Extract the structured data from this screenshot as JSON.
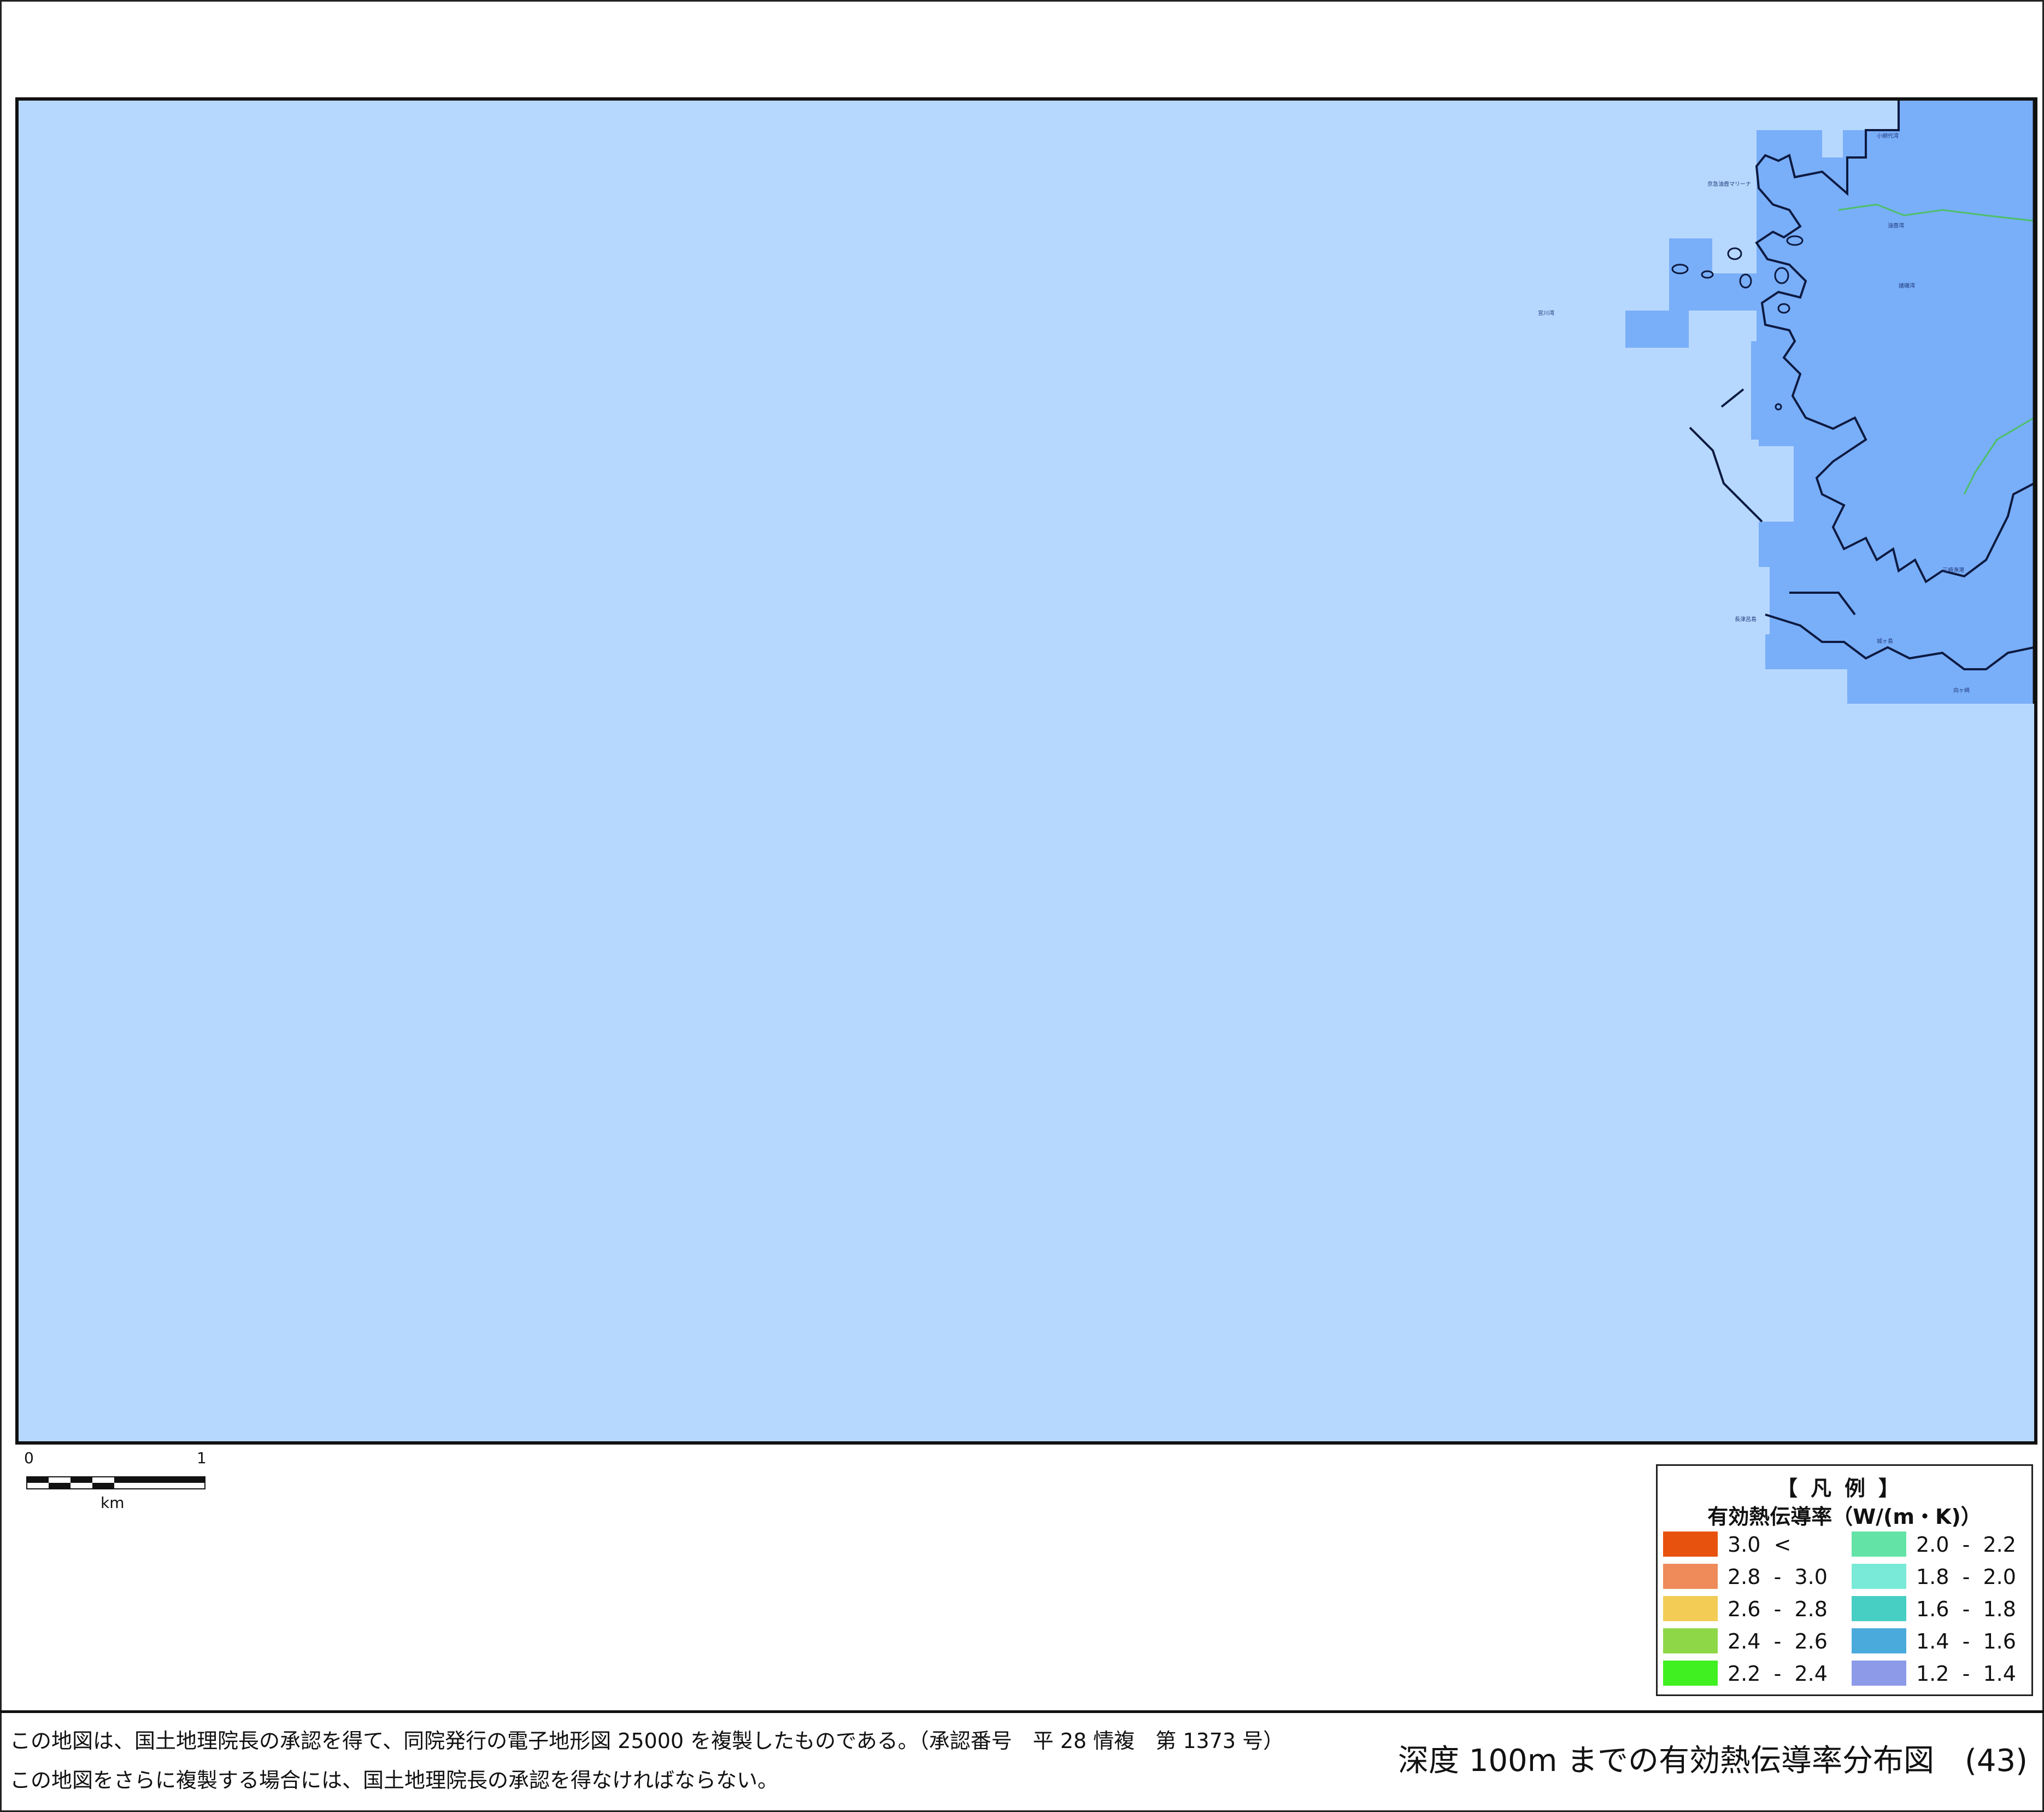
{
  "map": {
    "sea_color": "#b7d8fe",
    "land_color": "#79aef9",
    "place_labels": [
      "小網代湾",
      "京急油壺マリーナ",
      "油壺湾",
      "諸磯湾",
      "城ヶ島",
      "三崎漁港",
      "長津呂島",
      "向ヶ崎",
      "宮川湾"
    ]
  },
  "scale": {
    "start": "0",
    "end": "1",
    "unit": "km"
  },
  "legend": {
    "title": "【凡例】",
    "unit": "有効熱伝導率（W/(m・K)）",
    "items": [
      {
        "label": "3.0  <",
        "color": "#e8520f"
      },
      {
        "label": "2.8  -  3.0",
        "color": "#ef8a5a"
      },
      {
        "label": "2.6  -  2.8",
        "color": "#f2cc55"
      },
      {
        "label": "2.4  -  2.6",
        "color": "#8ed847"
      },
      {
        "label": "2.2  -  2.4",
        "color": "#41f021"
      },
      {
        "label": "2.0  -  2.2",
        "color": "#63e4a6"
      },
      {
        "label": "1.8  -  2.0",
        "color": "#79ead7"
      },
      {
        "label": "1.6  -  1.8",
        "color": "#47cfc3"
      },
      {
        "label": "1.4  -  1.6",
        "color": "#4aaadb"
      },
      {
        "label": "1.2  -  1.4",
        "color": "#8c9ae8"
      }
    ]
  },
  "footer": {
    "note_line1": "この地図は、国土地理院長の承認を得て、同院発行の電子地形図 25000 を複製したものである。（承認番号　平 28 情複　第 1373 号）",
    "note_line2": "この地図をさらに複製する場合には、国土地理院長の承認を得なければならない。",
    "title": "深度 100m までの有効熱伝導率分布図　(43)"
  }
}
